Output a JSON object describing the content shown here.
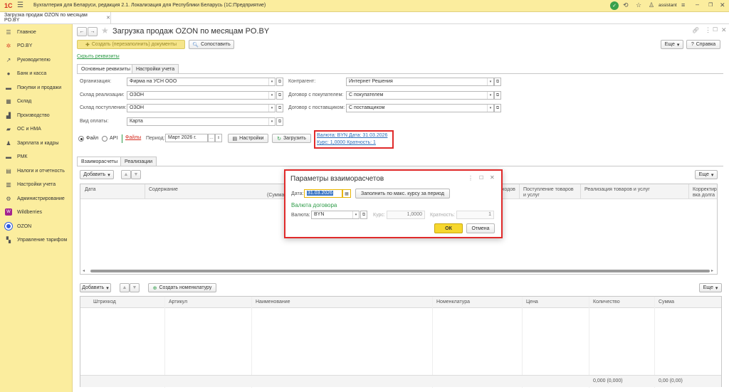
{
  "app": {
    "logo": "1С",
    "title": "Бухгалтерия для Беларуси, редакция 2.1. Локализация для Республики Беларусь",
    "platform": "(1С:Предприятие)",
    "user": "assistant",
    "accent": "#fbed9e"
  },
  "tabs": [
    {
      "label": "Загрузка продаж OZON по месяцам PO.BY"
    }
  ],
  "sidebar": {
    "items": [
      {
        "label": "Главное",
        "icon": "menu-icon"
      },
      {
        "label": "PO.BY",
        "icon": "star-icon"
      },
      {
        "label": "Руководителю",
        "icon": "chart-icon"
      },
      {
        "label": "Банк и касса",
        "icon": "bank-icon"
      },
      {
        "label": "Покупки и продажи",
        "icon": "cart-icon"
      },
      {
        "label": "Склад",
        "icon": "warehouse-icon"
      },
      {
        "label": "Производство",
        "icon": "factory-icon"
      },
      {
        "label": "ОС и НМА",
        "icon": "truck-icon"
      },
      {
        "label": "Зарплата и кадры",
        "icon": "people-icon"
      },
      {
        "label": "РМК",
        "icon": "cart-icon"
      },
      {
        "label": "Налоги и отчетность",
        "icon": "tax-icon"
      },
      {
        "label": "Настройки учета",
        "icon": "settings-doc-icon"
      },
      {
        "label": "Администрирование",
        "icon": "gear-icon"
      },
      {
        "label": "Wildberries",
        "icon": "wb-icon"
      },
      {
        "label": "OZON",
        "icon": "ozon-icon"
      },
      {
        "label": "Управление тарифом",
        "icon": "tariff-icon"
      }
    ]
  },
  "form": {
    "title": "Загрузка продаж OZON по месяцам PO.BY",
    "create_docs": "Создать (перезаполнить) документы",
    "match": "Сопоставить",
    "more": "Еще",
    "help": "Справка",
    "hide_details": "Скрыть реквизиты",
    "tab_main": "Основные реквизиты",
    "tab_settings": "Настройки учета",
    "org_label": "Организация:",
    "org_value": "Фирма на УСН ООО",
    "wh_sale_label": "Склад реализации:",
    "wh_sale_value": "ОЗОН",
    "wh_in_label": "Склад поступления:",
    "wh_in_value": "ОЗОН",
    "pay_label": "Вид оплаты:",
    "pay_value": "Карта",
    "contractor_label": "Контрагент:",
    "contractor_value": "Интернет Решения",
    "contract_buyer_label": "Договор с покупателем:",
    "contract_buyer_value": "С покупателем",
    "contract_supplier_label": "Договор с поставщиком:",
    "contract_supplier_value": "С поставщиком",
    "src_file": "Файл",
    "src_api": "API",
    "files": "Файлы",
    "period_label": "Период:",
    "period_value": "Март 2026 г.",
    "settings_btn": "Настройки",
    "load_btn": "Загрузить",
    "currency_line1": "Валюта: BYN Дата: 31.03.2026",
    "currency_line2": "Курс: 1,0000 Кратность: 1",
    "subtab_settlements": "Взаиморасчеты",
    "subtab_sales": "Реализации",
    "add": "Добавить",
    "table1_headers": [
      "Дата",
      "Содержание",
      "(Сумма",
      "ходов",
      "Поступление товаров и услуг",
      "Реализация товаров и услуг",
      "Корректир вка долга"
    ],
    "add2": "Добавить",
    "create_nomenclature": "Создать номенклатуру",
    "table2_headers": [
      "Штрихкод",
      "Артикул",
      "Наименование",
      "Номенклатура",
      "Цена",
      "Количество",
      "Сумма"
    ],
    "total_qty": "0,000 (0,000)",
    "total_sum": "0,00 (0,00)"
  },
  "dialog": {
    "title": "Параметры взаиморасчетов",
    "date_label": "Дата:",
    "date_value": "31.03.2026",
    "fill_btn": "Заполнить по макс. курсу за период",
    "section": "Валюта договора",
    "currency_label": "Валюта:",
    "currency_value": "BYN",
    "rate_label": "Курс:",
    "rate_value": "1,0000",
    "mult_label": "Кратность:",
    "mult_value": "1",
    "ok": "ОК",
    "cancel": "Отмена",
    "section_color": "#2e9b48",
    "highlight": "#e02a2a"
  }
}
